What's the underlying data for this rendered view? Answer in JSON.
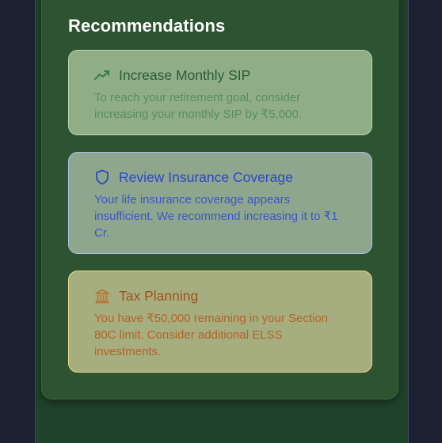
{
  "recommendations": {
    "title": "Recommendations",
    "items": [
      {
        "icon": "trending-up-icon",
        "title": "Increase Monthly SIP",
        "body": "To reach your retirement goal, consider increasing your monthly SIP by ₹5,000.",
        "color": "#2c5a35"
      },
      {
        "icon": "shield-icon",
        "title": "Review Insurance Coverage",
        "body": "Your life insurance coverage appears insufficient. We recommend increasing it to ₹1 Cr.",
        "color": "#2a47c6"
      },
      {
        "icon": "bank-icon",
        "title": "Tax Planning",
        "body": "You have ₹50,000 remaining in your Section 80C limit. Consider additional ELSS investments.",
        "color": "#a05320"
      }
    ]
  }
}
